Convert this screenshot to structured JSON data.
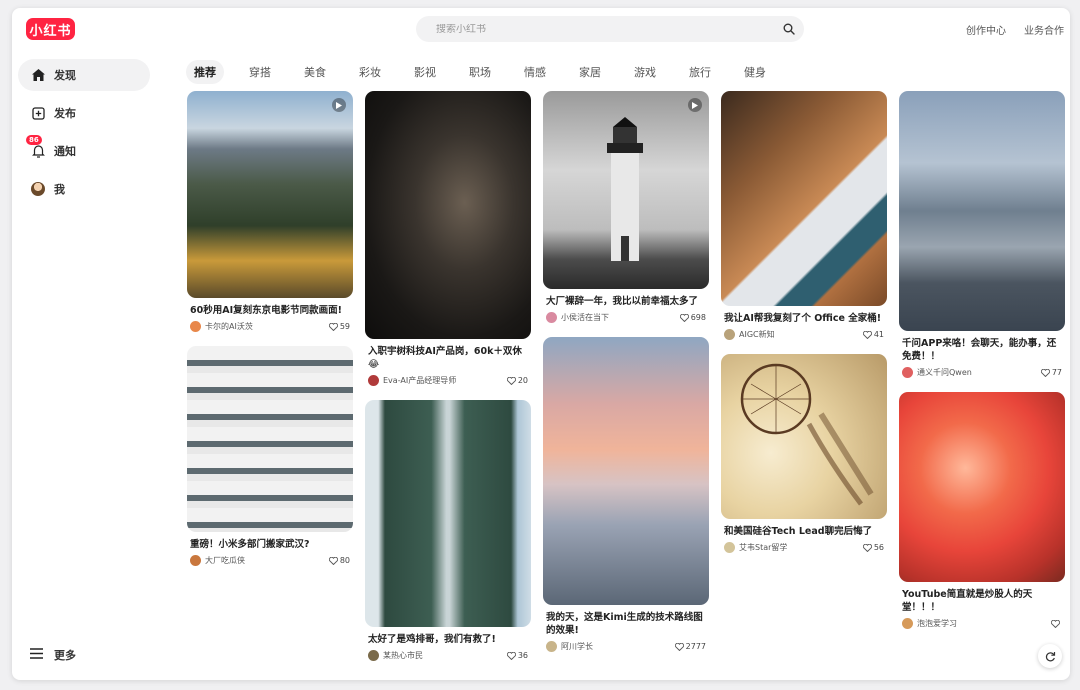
{
  "brand": {
    "logo_text": "小红书",
    "color": "#ff2442"
  },
  "search": {
    "placeholder": "搜索小红书"
  },
  "header": {
    "links": [
      "创作中心",
      "业务合作"
    ]
  },
  "sidebar": {
    "items": [
      {
        "label": "发现",
        "icon": "home-icon",
        "active": true
      },
      {
        "label": "发布",
        "icon": "plus-square-icon"
      },
      {
        "label": "通知",
        "icon": "bell-icon",
        "badge": "86"
      },
      {
        "label": "我",
        "icon": "avatar-icon"
      }
    ],
    "more_label": "更多"
  },
  "tabs": [
    "推荐",
    "穿搭",
    "美食",
    "彩妆",
    "影视",
    "职场",
    "情感",
    "家居",
    "游戏",
    "旅行",
    "健身"
  ],
  "feed": [
    {
      "title": "60秒用AI复刻东京电影节同款画面!",
      "author": "卡尔的AI沃茨",
      "likes": "59",
      "image": "mountain",
      "video": true
    },
    {
      "title": "重磅！小米多部门搬家武汉?",
      "author": "大厂吃瓜侠",
      "likes": "80",
      "image": "building"
    },
    {
      "title": "入职宇树科技AI产品岗，60k＋双休😂",
      "author": "Eva-AI产品经理导师",
      "likes": "20",
      "image": "machine"
    },
    {
      "title": "太好了是鸡排哥，我们有救了!",
      "author": "某热心市民",
      "likes": "36",
      "image": "bridge"
    },
    {
      "title": "大厂裸辞一年，我比以前幸福太多了",
      "author": "小侯活在当下",
      "likes": "698",
      "image": "lighthouse",
      "video": true
    },
    {
      "title": "我的天，这是Kimi生成的技术路线图的效果!",
      "author": "阿川学长",
      "likes": "2777",
      "image": "sea"
    },
    {
      "title": "我让AI帮我复刻了个 Office 全家桶!",
      "author": "AIGC新知",
      "likes": "41",
      "image": "desk"
    },
    {
      "title": "和美国硅谷Tech Lead聊完后悔了",
      "author": "艾韦Star留学",
      "likes": "56",
      "image": "dreamcatcher"
    },
    {
      "title": "千问APP来咯！会聊天，能办事，还免费！！",
      "author": "通义千问Qwen",
      "likes": "77",
      "image": "city"
    },
    {
      "title": "YouTube简直就是炒股人的天堂！！！",
      "author": "泡泡爱学习",
      "likes": "",
      "image": "flower"
    }
  ]
}
